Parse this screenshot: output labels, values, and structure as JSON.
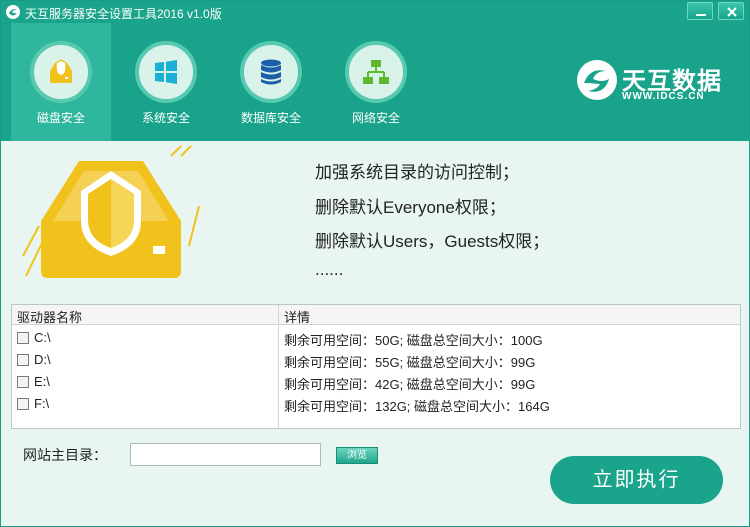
{
  "window": {
    "title": "天互服务器安全设置工具2016 v1.0版"
  },
  "nav": {
    "tabs": [
      {
        "label": "磁盘安全",
        "icon": "disk-shield-icon",
        "active": true
      },
      {
        "label": "系统安全",
        "icon": "windows-icon",
        "active": false
      },
      {
        "label": "数据库安全",
        "icon": "database-icon",
        "active": false
      },
      {
        "label": "网络安全",
        "icon": "network-icon",
        "active": false
      }
    ]
  },
  "brand": {
    "name": "天互数据",
    "url": "WWW.IDCS.CN",
    "logo_icon": "brand-swirl-icon"
  },
  "info": {
    "lines": [
      "加强系统目录的访问控制；",
      "删除默认Everyone权限；",
      "删除默认Users，Guests权限；",
      "......"
    ]
  },
  "table": {
    "headers": {
      "name": "驱动器名称",
      "detail": "详情"
    },
    "rows": [
      {
        "drive": "C:\\",
        "detail": "剩余可用空间：50G; 磁盘总空间大小：100G",
        "checked": false
      },
      {
        "drive": "D:\\",
        "detail": "剩余可用空间：55G; 磁盘总空间大小：99G",
        "checked": false
      },
      {
        "drive": "E:\\",
        "detail": "剩余可用空间：42G; 磁盘总空间大小：99G",
        "checked": false
      },
      {
        "drive": "F:\\",
        "detail": "剩余可用空间：132G; 磁盘总空间大小：164G",
        "checked": false
      }
    ]
  },
  "site_root": {
    "label": "网站主目录：",
    "value": "",
    "browse_label": "浏览"
  },
  "actions": {
    "run_label": "立即执行"
  },
  "colors": {
    "accent": "#1aa48b",
    "background": "#e9f5f0",
    "illustration": "#f1c21b"
  }
}
